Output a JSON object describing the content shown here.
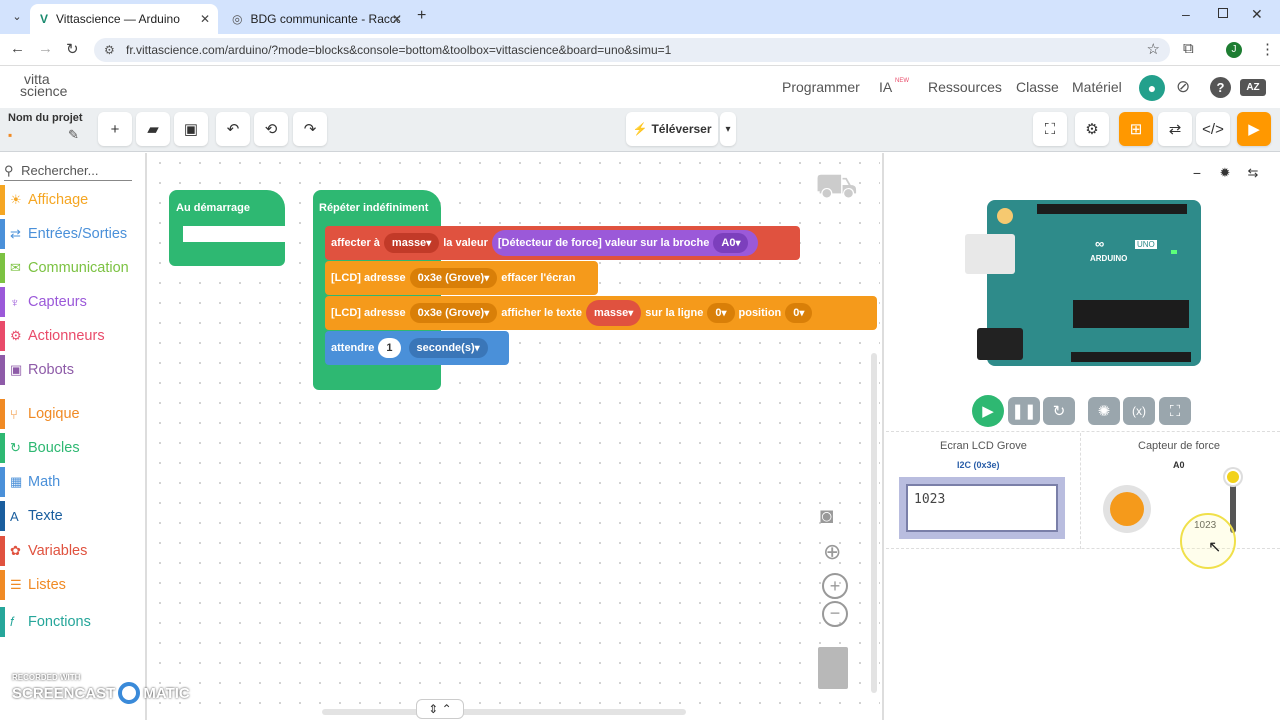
{
  "browser": {
    "tabs": [
      {
        "label": "Vittascience — Arduino"
      },
      {
        "label": "BDG communicante - Raccorde"
      }
    ],
    "url": "fr.vittascience.com/arduino/?mode=blocks&console=bottom&toolbox=vittascience&board=uno&simu=1",
    "profile_initial": "J"
  },
  "app": {
    "logo_line1": "vitta",
    "logo_line2": "science",
    "nav": [
      "Programmer",
      "IA",
      "Ressources",
      "Classe",
      "Matériel"
    ],
    "ia_badge": "NEW",
    "project_label": "Nom du projet",
    "upload_label": "Téléverser"
  },
  "toolbox": {
    "search_placeholder": "Rechercher...",
    "categories": [
      {
        "label": "Affichage",
        "color": "#f5a623",
        "icon": "☀"
      },
      {
        "label": "Entrées/Sorties",
        "color": "#4a90d9",
        "icon": "⇄"
      },
      {
        "label": "Communication",
        "color": "#7cc242",
        "icon": "✉"
      },
      {
        "label": "Capteurs",
        "color": "#9b59d9",
        "icon": "♆"
      },
      {
        "label": "Actionneurs",
        "color": "#e94b6a",
        "icon": "⚙"
      },
      {
        "label": "Robots",
        "color": "#8e5ba8",
        "icon": "▣"
      },
      {
        "label": "Logique",
        "color": "#f08a24",
        "icon": "⑂"
      },
      {
        "label": "Boucles",
        "color": "#2eb872",
        "icon": "↻"
      },
      {
        "label": "Math",
        "color": "#4a90d9",
        "icon": "▦"
      },
      {
        "label": "Texte",
        "color": "#1a5e9e",
        "icon": "A"
      },
      {
        "label": "Variables",
        "color": "#e0523f",
        "icon": "✿"
      },
      {
        "label": "Listes",
        "color": "#f08a24",
        "icon": "☰"
      },
      {
        "label": "Fonctions",
        "color": "#26a69a",
        "icon": "𝑓"
      }
    ]
  },
  "blocks": {
    "start_label": "Au démarrage",
    "loop_label": "Répéter indéfiniment",
    "assign_label": "affecter à",
    "assign_var": "masse",
    "assign_value_label": "la valeur",
    "sensor_label": "[Détecteur de force] valeur sur la broche",
    "sensor_pin": "A0",
    "lcd1_label": "[LCD] adresse",
    "lcd1_addr": "0x3e (Grove)",
    "lcd1_action": "effacer l'écran",
    "lcd2_label": "[LCD] adresse",
    "lcd2_addr": "0x3e (Grove)",
    "lcd2_action": "afficher le texte",
    "lcd2_text_var": "masse",
    "lcd2_line_label": "sur la ligne",
    "lcd2_line": "0",
    "lcd2_pos_label": "position",
    "lcd2_pos": "0",
    "wait_label": "attendre",
    "wait_value": "1",
    "wait_unit": "seconde(s)"
  },
  "simulator": {
    "board_label": "ARDUINO",
    "board_model": "UNO",
    "lcd_title": "Ecran LCD Grove",
    "lcd_bus": "I2C (0x3e)",
    "lcd_text": "1023",
    "force_title": "Capteur de force",
    "force_pin": "A0",
    "force_value": "1023",
    "force_level": 1.0
  },
  "watermark": {
    "line1": "RECORDED WITH",
    "line2a": "SCREENCAST",
    "line2b": "MATIC"
  }
}
